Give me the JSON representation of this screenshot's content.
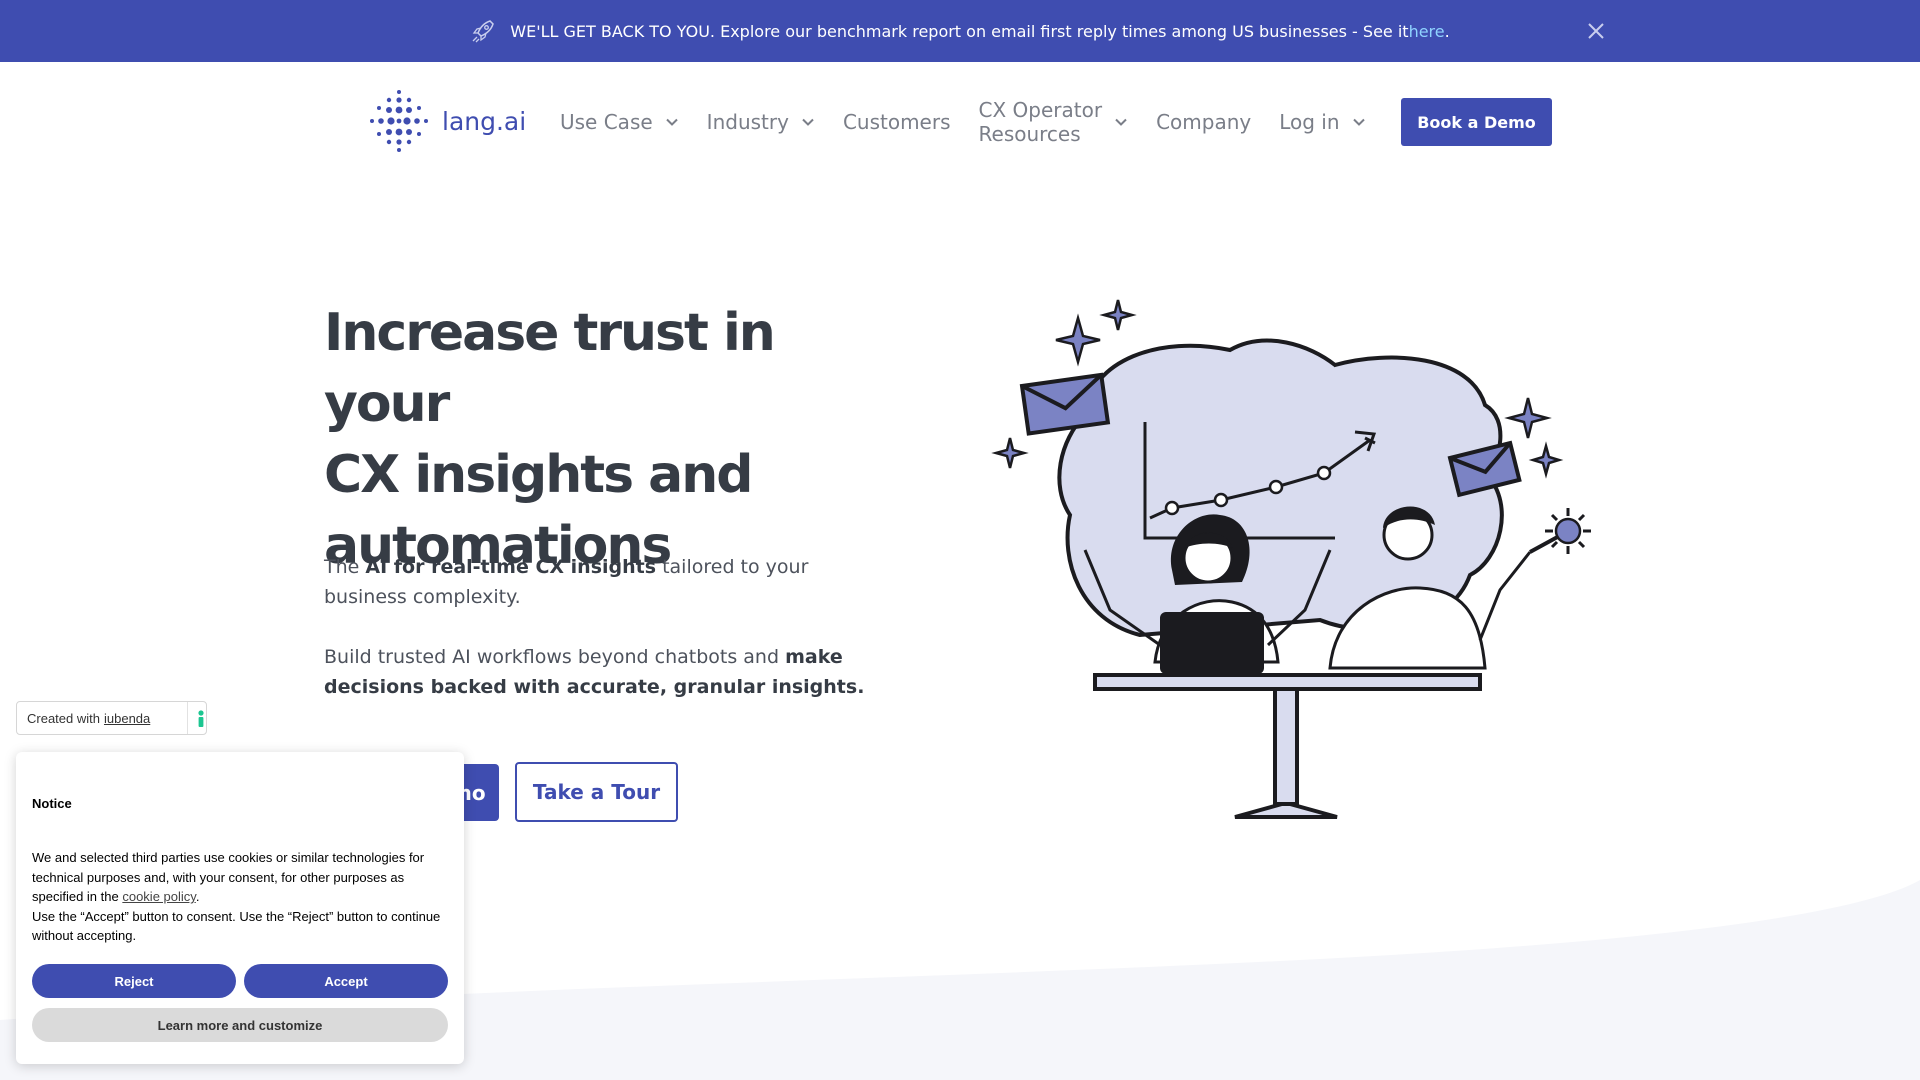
{
  "announcement": {
    "text": "WE'LL GET BACK TO YOU. Explore our benchmark report on email first reply times among US businesses - See it ",
    "link": "here",
    "period": ".",
    "icons": [
      "rocket-icon",
      "close-icon"
    ]
  },
  "header": {
    "logo_text": "lang.ai",
    "nav": [
      {
        "label": "Use Case",
        "dropdown": true
      },
      {
        "label": "Industry",
        "dropdown": true
      },
      {
        "label": "Customers",
        "dropdown": false
      },
      {
        "label_line1": "CX Operator",
        "label_line2": "Resources",
        "dropdown": true
      },
      {
        "label": "Company",
        "dropdown": false
      },
      {
        "label": "Log in",
        "dropdown": true
      }
    ],
    "cta": "Book a Demo"
  },
  "hero": {
    "title_line1": "Increase trust in your",
    "title_line2": "CX insights and",
    "title_line3": "automations",
    "p1_pre": "The ",
    "p1_bold": "AI for real-time CX insights",
    "p1_post": " tailored to your business complexity.",
    "p2_pre": "Build trusted AI workflows beyond chatbots and ",
    "p2_bold": "make decisions backed with accurate, granular insights.",
    "primary_button": "Book a Demo",
    "secondary_button": "Take a Tour"
  },
  "iubenda": {
    "prefix": "Created with",
    "link": "iubenda"
  },
  "cookie": {
    "title": "Notice",
    "body_1": "We and selected third parties use cookies or similar technologies for technical purposes and, with your consent, for other purposes as specified in the ",
    "body_link": "cookie policy",
    "body_2": ".",
    "body_3": "Use the “Accept” button to consent. Use the “Reject” button to continue without accepting.",
    "reject": "Reject",
    "accept": "Accept",
    "learn_more": "Learn more and customize"
  },
  "colors": {
    "brand": "#3f4db0",
    "text_dark": "#363c45",
    "text_muted": "#7a7e88",
    "illustration_fill": "#d9dcef",
    "illustration_accent": "#7b83c4",
    "link": "#8fd3ff"
  }
}
